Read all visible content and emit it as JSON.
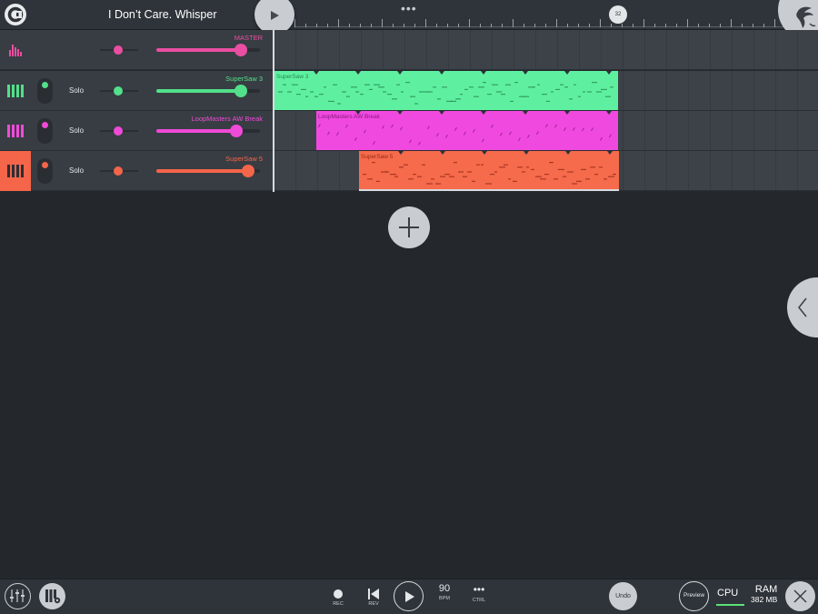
{
  "header": {
    "song_title": "I Don’t Care. Whisper",
    "more_glyph": "•••",
    "marker_label": "32"
  },
  "tracks": [
    {
      "name": "MASTER",
      "solo_label": "",
      "color": "#ea4ea2",
      "icon": "mixer-bars-icon",
      "volume": 0.82
    },
    {
      "name": "SuperSaw 3",
      "solo_label": "Solo",
      "color": "#52e08a",
      "icon": "piano-keys-icon",
      "volume": 0.82
    },
    {
      "name": "LoopMasters AW Break",
      "solo_label": "Solo",
      "color": "#f04ad8",
      "icon": "piano-keys-icon",
      "volume": 0.77
    },
    {
      "name": "SuperSaw 5",
      "solo_label": "Solo",
      "color": "#f4654a",
      "icon": "piano-keys-icon",
      "volume": 0.89
    }
  ],
  "clips": [
    {
      "label": "SuperSaw 3",
      "color": "#5ef0a0",
      "text_color": "#2a8a58"
    },
    {
      "label": "LoopMasters AW Break",
      "color": "#f049e0",
      "text_color": "#8a1a7e"
    },
    {
      "label": "SuperSaw 5",
      "color": "#f56b4c",
      "text_color": "#9a2c18"
    }
  ],
  "transport": {
    "rec_label": "REC",
    "rev_label": "REV",
    "bpm_value": "90",
    "bpm_label": "BPM",
    "ctrl_glyph": "•••",
    "ctrl_label": "CTRL",
    "undo_label": "Undo",
    "preview_label": "Preview",
    "cpu_label": "CPU",
    "ram_label": "RAM",
    "ram_value": "382 MB"
  },
  "colors": {
    "background": "#24282d",
    "bar": "#2f343a",
    "track_bg": "#383d43",
    "accent_light": "#c9cdd1"
  }
}
